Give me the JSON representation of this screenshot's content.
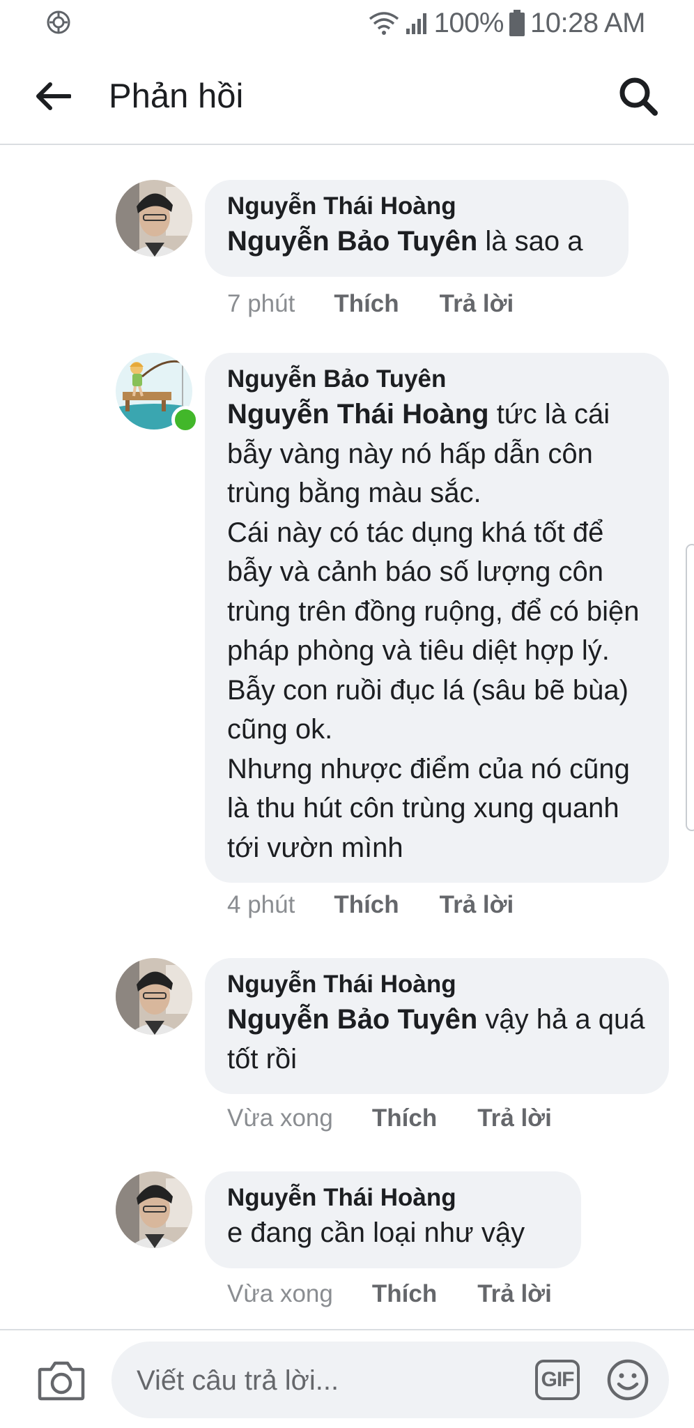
{
  "status_bar": {
    "battery_percent": "100%",
    "time": "10:28 AM",
    "icons": [
      "settings-icon",
      "wifi-icon",
      "signal-icon",
      "battery-icon"
    ]
  },
  "header": {
    "title": "Phản hồi",
    "back_icon": "arrow-left-icon",
    "search_icon": "search-icon"
  },
  "comments": [
    {
      "author": "Nguyễn Thái Hoàng",
      "mention": "Nguyễn Bảo Tuyên",
      "text": " là sao a",
      "time": "7 phút",
      "like_label": "Thích",
      "reply_label": "Trả lời",
      "online": false
    },
    {
      "author": "Nguyễn Bảo Tuyên",
      "mention": "Nguyễn Thái Hoàng",
      "text": " tức là cái bẫy vàng này nó hấp dẫn côn trùng bằng màu sắc.\nCái này có tác dụng khá tốt để bẫy và cảnh báo số lượng côn trùng trên đồng ruộng, để có biện pháp phòng và tiêu diệt hợp lý. Bẫy con ruồi đục lá (sâu bẽ bùa) cũng ok.\nNhưng nhược điểm của nó cũng là thu hút côn trùng xung quanh tới vườn mình",
      "time": "4 phút",
      "like_label": "Thích",
      "reply_label": "Trả lời",
      "online": true
    },
    {
      "author": "Nguyễn Thái Hoàng",
      "mention": "Nguyễn Bảo Tuyên",
      "text": " vậy hả a quá tốt rồi",
      "time": "Vừa xong",
      "like_label": "Thích",
      "reply_label": "Trả lời",
      "online": false
    },
    {
      "author": "Nguyễn Thái Hoàng",
      "mention": "",
      "text": "e đang cần loại như vậy",
      "time": "Vừa xong",
      "like_label": "Thích",
      "reply_label": "Trả lời",
      "online": false
    }
  ],
  "composer": {
    "placeholder": "Viết câu trả lời...",
    "value": "",
    "gif_label": "GIF",
    "camera_icon": "camera-icon",
    "emoji_icon": "smiley-icon"
  },
  "colors": {
    "bubble": "#f0f2f5",
    "divider": "#dadde1",
    "meta_time": "#8a8d91",
    "meta_action": "#65676b",
    "online": "#42b72a"
  }
}
